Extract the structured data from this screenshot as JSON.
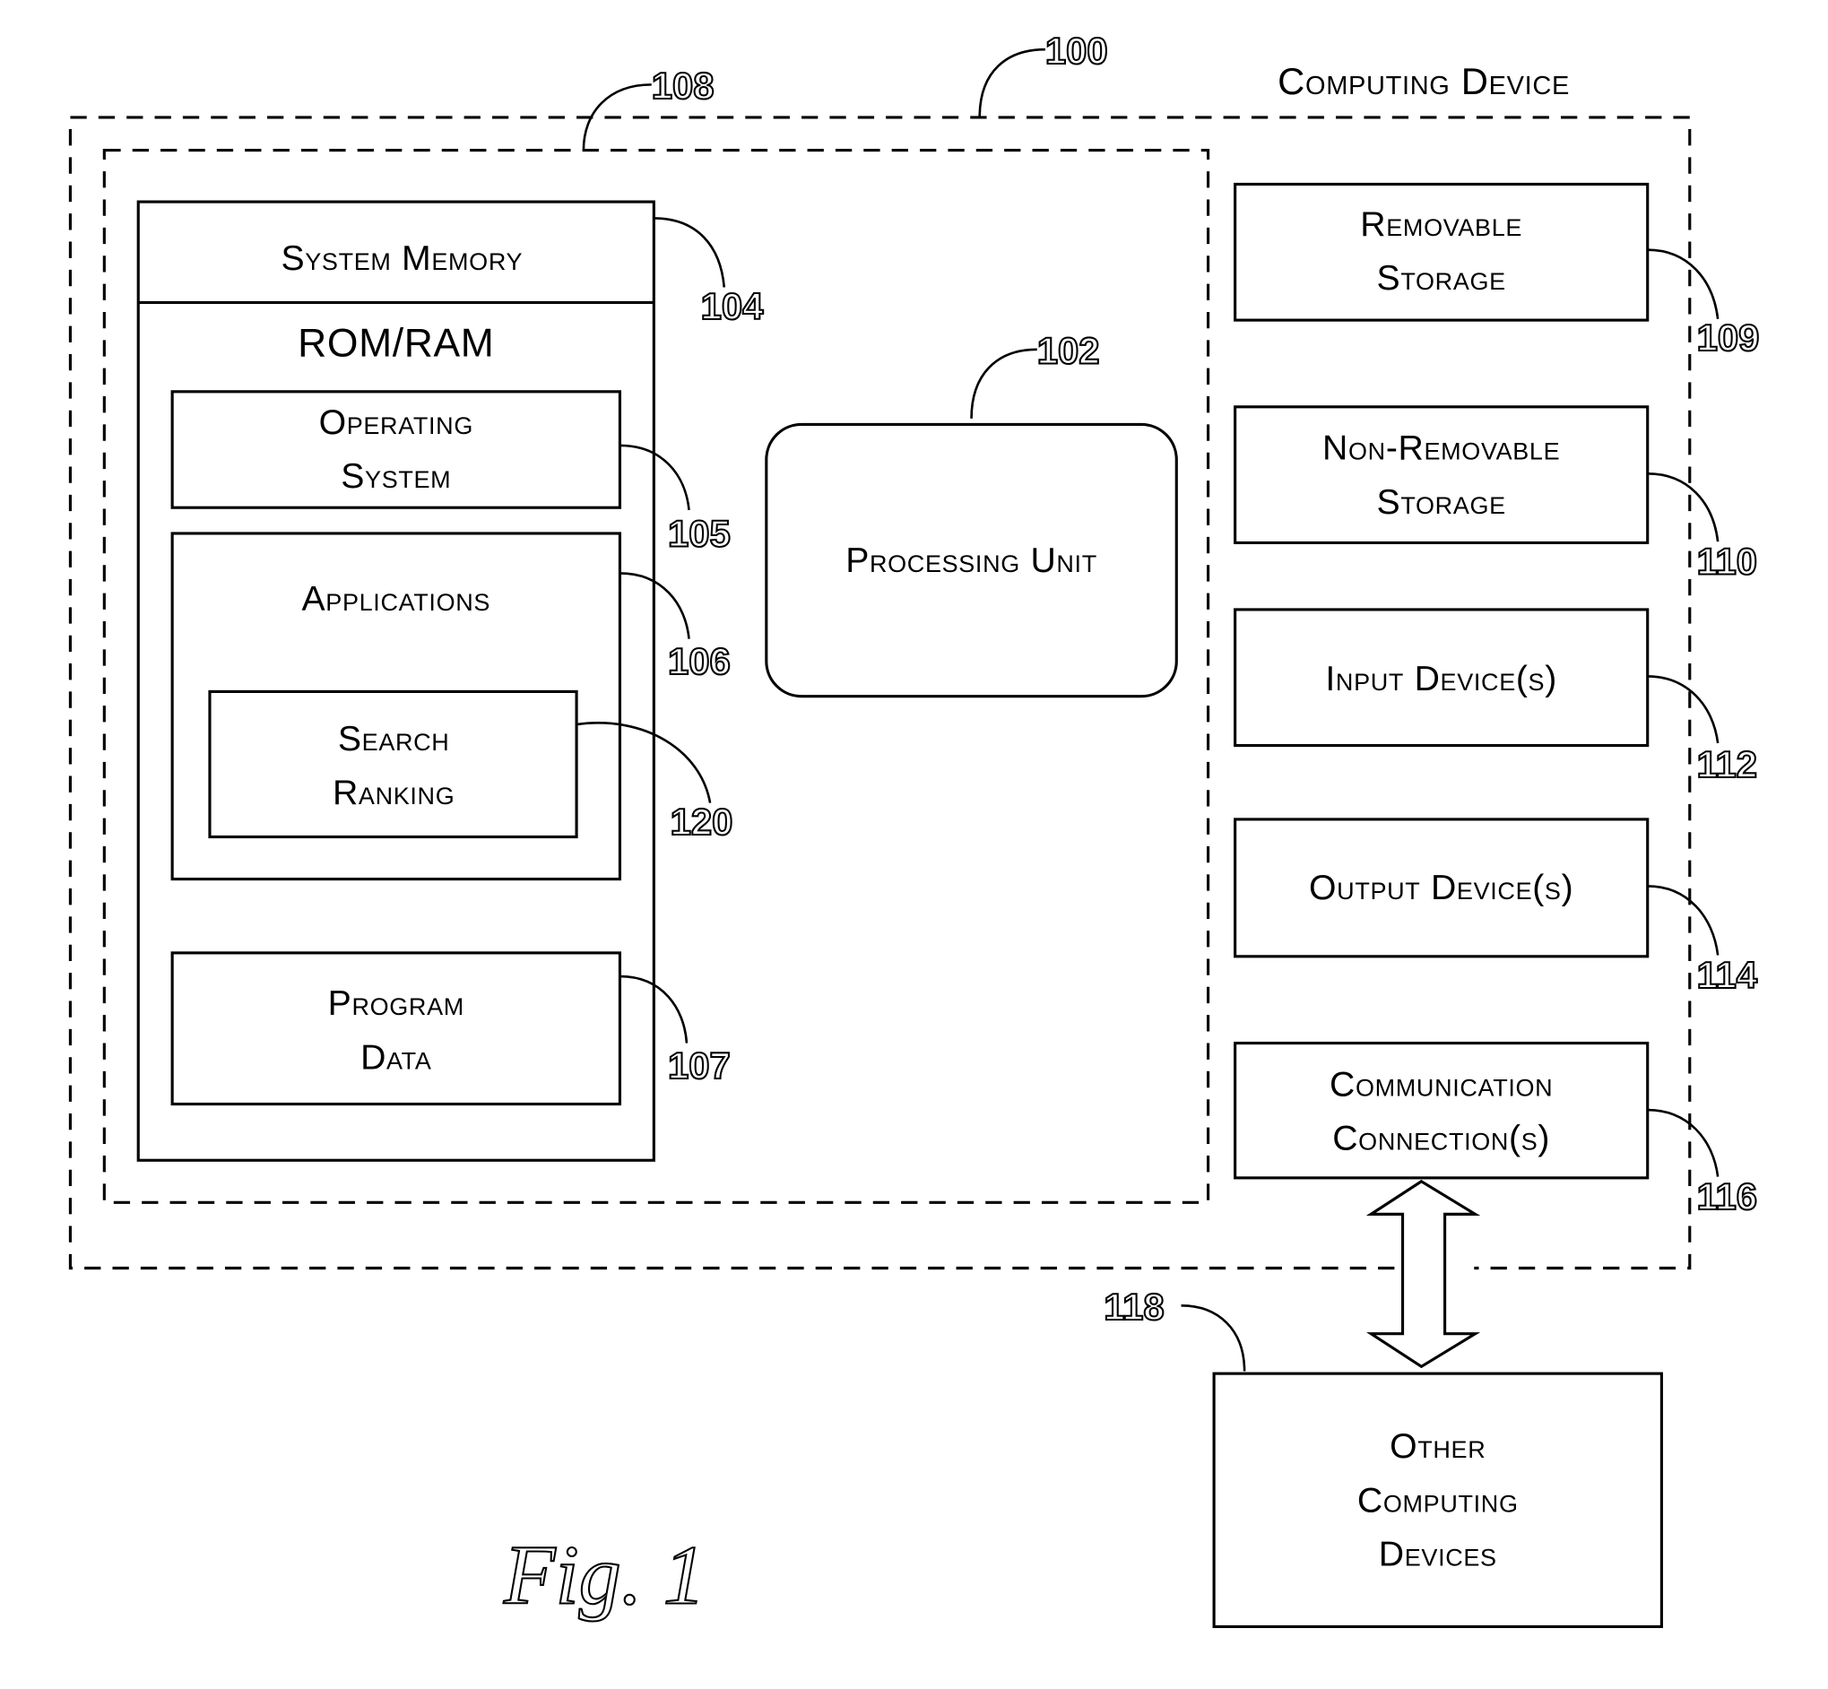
{
  "figure": {
    "caption": "Fig. 1",
    "title": "Computing Device",
    "refs": {
      "computing_device": "100",
      "processing_unit": "102",
      "system_memory": "104",
      "operating_system": "105",
      "applications": "106",
      "program_data": "107",
      "system_boundary": "108",
      "removable_storage": "109",
      "non_removable_storage": "110",
      "input_devices": "112",
      "output_devices": "114",
      "communication_connections": "116",
      "other_computing_devices": "118",
      "search_ranking": "120"
    },
    "labels": {
      "system_memory": "System Memory",
      "rom_ram": "ROM/RAM",
      "operating_system": [
        "Operating",
        "System"
      ],
      "applications": "Applications",
      "search_ranking": [
        "Search",
        "Ranking"
      ],
      "program_data": [
        "Program",
        "Data"
      ],
      "processing_unit": "Processing Unit",
      "removable_storage": [
        "Removable",
        "Storage"
      ],
      "non_removable_storage": [
        "Non-Removable",
        "Storage"
      ],
      "input_devices": "Input Device(s)",
      "output_devices": "Output Device(s)",
      "communication_connections": [
        "Communication",
        "Connection(s)"
      ],
      "other_computing_devices": [
        "Other",
        "Computing",
        "Devices"
      ]
    }
  }
}
